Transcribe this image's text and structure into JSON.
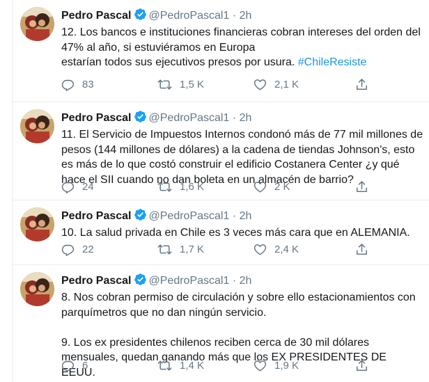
{
  "tweets": [
    {
      "name": "Pedro Pascal",
      "handle": "@PedroPascal1",
      "dot": "·",
      "time": "2h",
      "text": "12. Los bancos e instituciones financieras cobran intereses del orden del 47% al año, si estuviéramos en Europa\nestarían todos sus ejecutivos presos por usura. ",
      "hashtag": "#ChileResiste",
      "replies": "83",
      "retweets": "1,5 K",
      "likes": "2,1 K"
    },
    {
      "name": "Pedro Pascal",
      "handle": "@PedroPascal1",
      "dot": "·",
      "time": "2h",
      "text": "11. El Servicio de Impuestos Internos condonó más de 77 mil millones de pesos (144 millones de dólares) a la cadena de tiendas Johnson's, esto es más de lo que costó construir el edificio Costanera Center ¿y qué hace el SII cuando no dan boleta en un almacén de barrio?",
      "hashtag": "",
      "replies": "24",
      "retweets": "1,6 K",
      "likes": "2 K"
    },
    {
      "name": "Pedro Pascal",
      "handle": "@PedroPascal1",
      "dot": "·",
      "time": "2h",
      "text": "10. La salud privada en Chile es 3 veces más cara que en ALEMANIA.",
      "hashtag": "",
      "replies": "22",
      "retweets": "1,7 K",
      "likes": "2,4 K"
    },
    {
      "name": "Pedro Pascal",
      "handle": "@PedroPascal1",
      "dot": "·",
      "time": "2h",
      "text": "8. Nos cobran permiso de circulación y sobre ello estacionamientos con parquímetros que no dan ningún servicio.\n\n9. Los ex presidentes chilenos reciben cerca de 30 mil dólares mensuales, quedan ganando más que los EX PRESIDENTES DE EEUU.",
      "hashtag": "",
      "replies": "6",
      "retweets": "1,4 K",
      "likes": "1,9 K"
    }
  ],
  "icons": {
    "reply": "reply-icon",
    "retweet": "retweet-icon",
    "like": "heart-icon",
    "share": "share-icon",
    "verified": "verified-badge-icon"
  },
  "colors": {
    "verified": "#1da1f2",
    "hashtag": "#1b95e0",
    "muted": "#657786",
    "border": "#e6ecf0"
  }
}
